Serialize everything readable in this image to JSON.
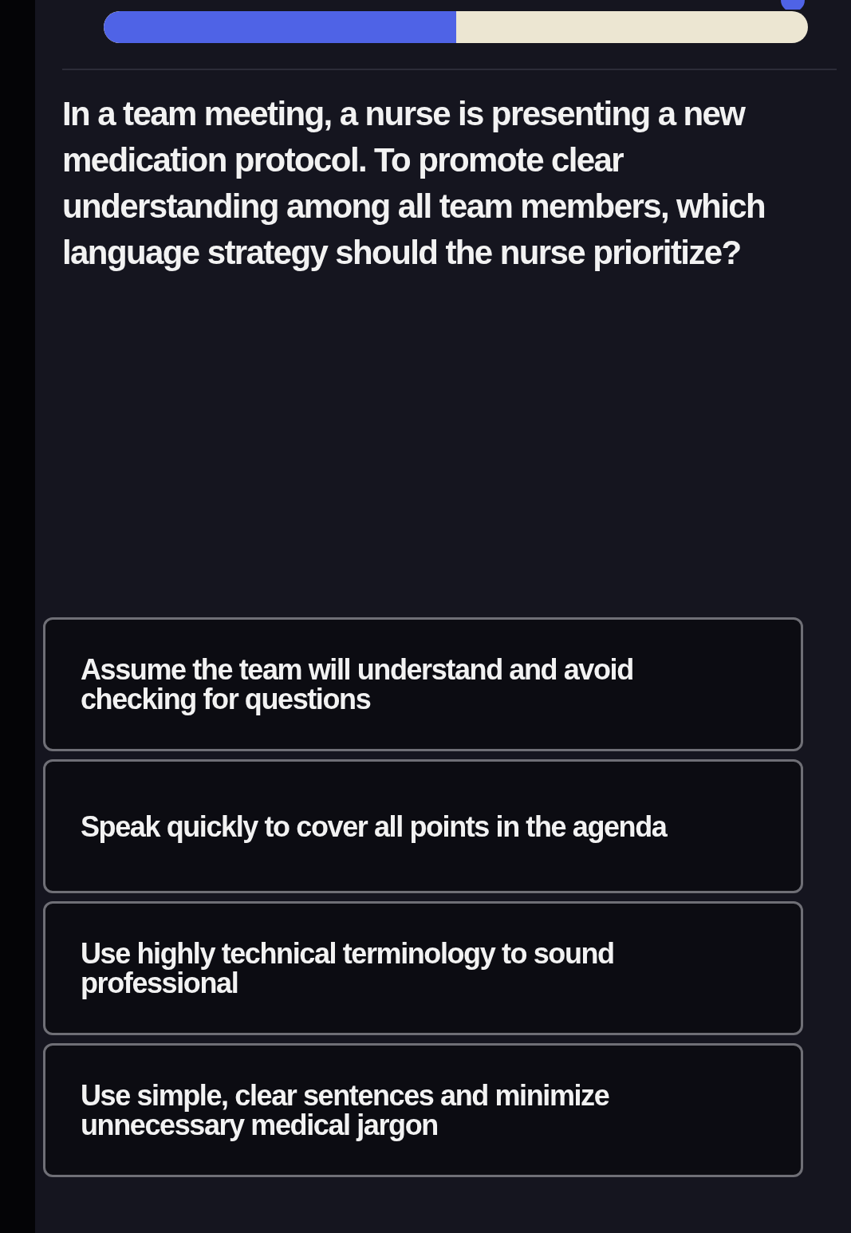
{
  "progress": {
    "level": 0.5
  },
  "question": "In a team meeting, a nurse is presenting a new medication protocol. To promote clear understanding among all team members, which language strategy should the nurse prioritize?",
  "options": [
    {
      "text": "Assume the team will understand and avoid checking for questions",
      "selected": false
    },
    {
      "text": "Speak quickly to cover all points in the agenda",
      "selected": false
    },
    {
      "text": "Use highly technical terminology to sound professional",
      "selected": false
    },
    {
      "text": "Use simple, clear sentences and minimize unnecessary medical jargon",
      "selected": false
    }
  ]
}
